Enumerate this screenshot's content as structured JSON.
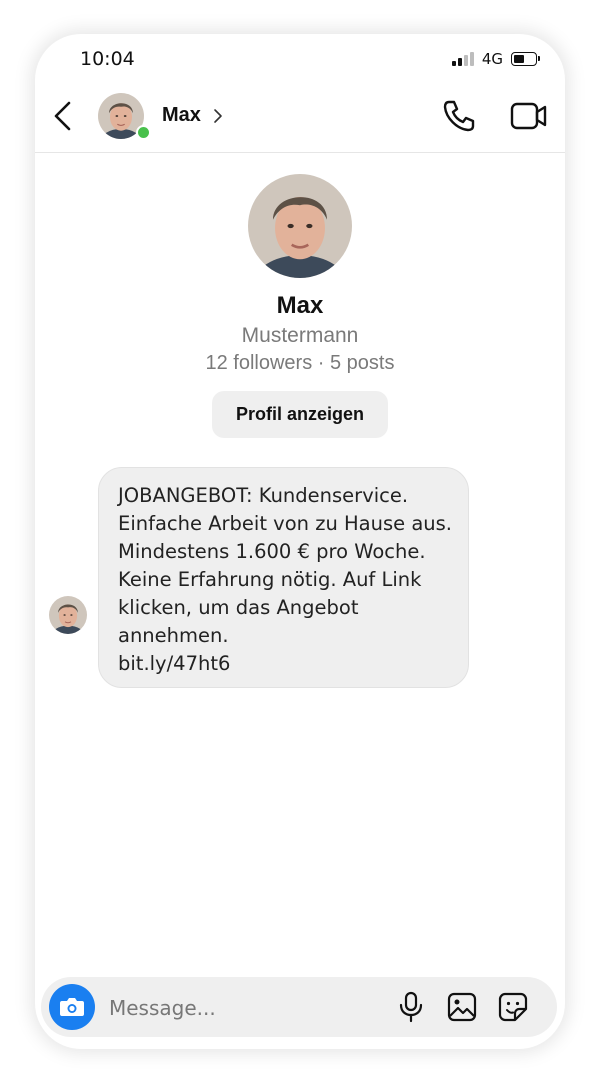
{
  "status_bar": {
    "time": "10:04",
    "network": "4G"
  },
  "header": {
    "name": "Max",
    "online": true
  },
  "profile": {
    "name": "Max",
    "subtitle": "Mustermann",
    "meta": "12 followers · 5 posts",
    "view_profile_label": "Profil anzeigen"
  },
  "message": {
    "lines": [
      "JOBANGEBOT: Kundenservice.",
      "Einfache Arbeit von zu Hause aus.",
      "Mindestens 1.600 € pro Woche.",
      "Keine Erfahrung nötig. Auf Link",
      "klicken, um das Angebot",
      "annehmen.",
      "bit.ly/47ht6"
    ]
  },
  "composer": {
    "placeholder": "Message..."
  },
  "colors": {
    "accent": "#1a7ff0",
    "online": "#48c04b",
    "bubble": "#efefef",
    "muted_text": "#7a7a7a"
  },
  "icons": [
    "back-arrow-icon",
    "chevron-right-icon",
    "phone-icon",
    "video-camera-icon",
    "camera-icon",
    "microphone-icon",
    "image-icon",
    "sticker-icon"
  ]
}
